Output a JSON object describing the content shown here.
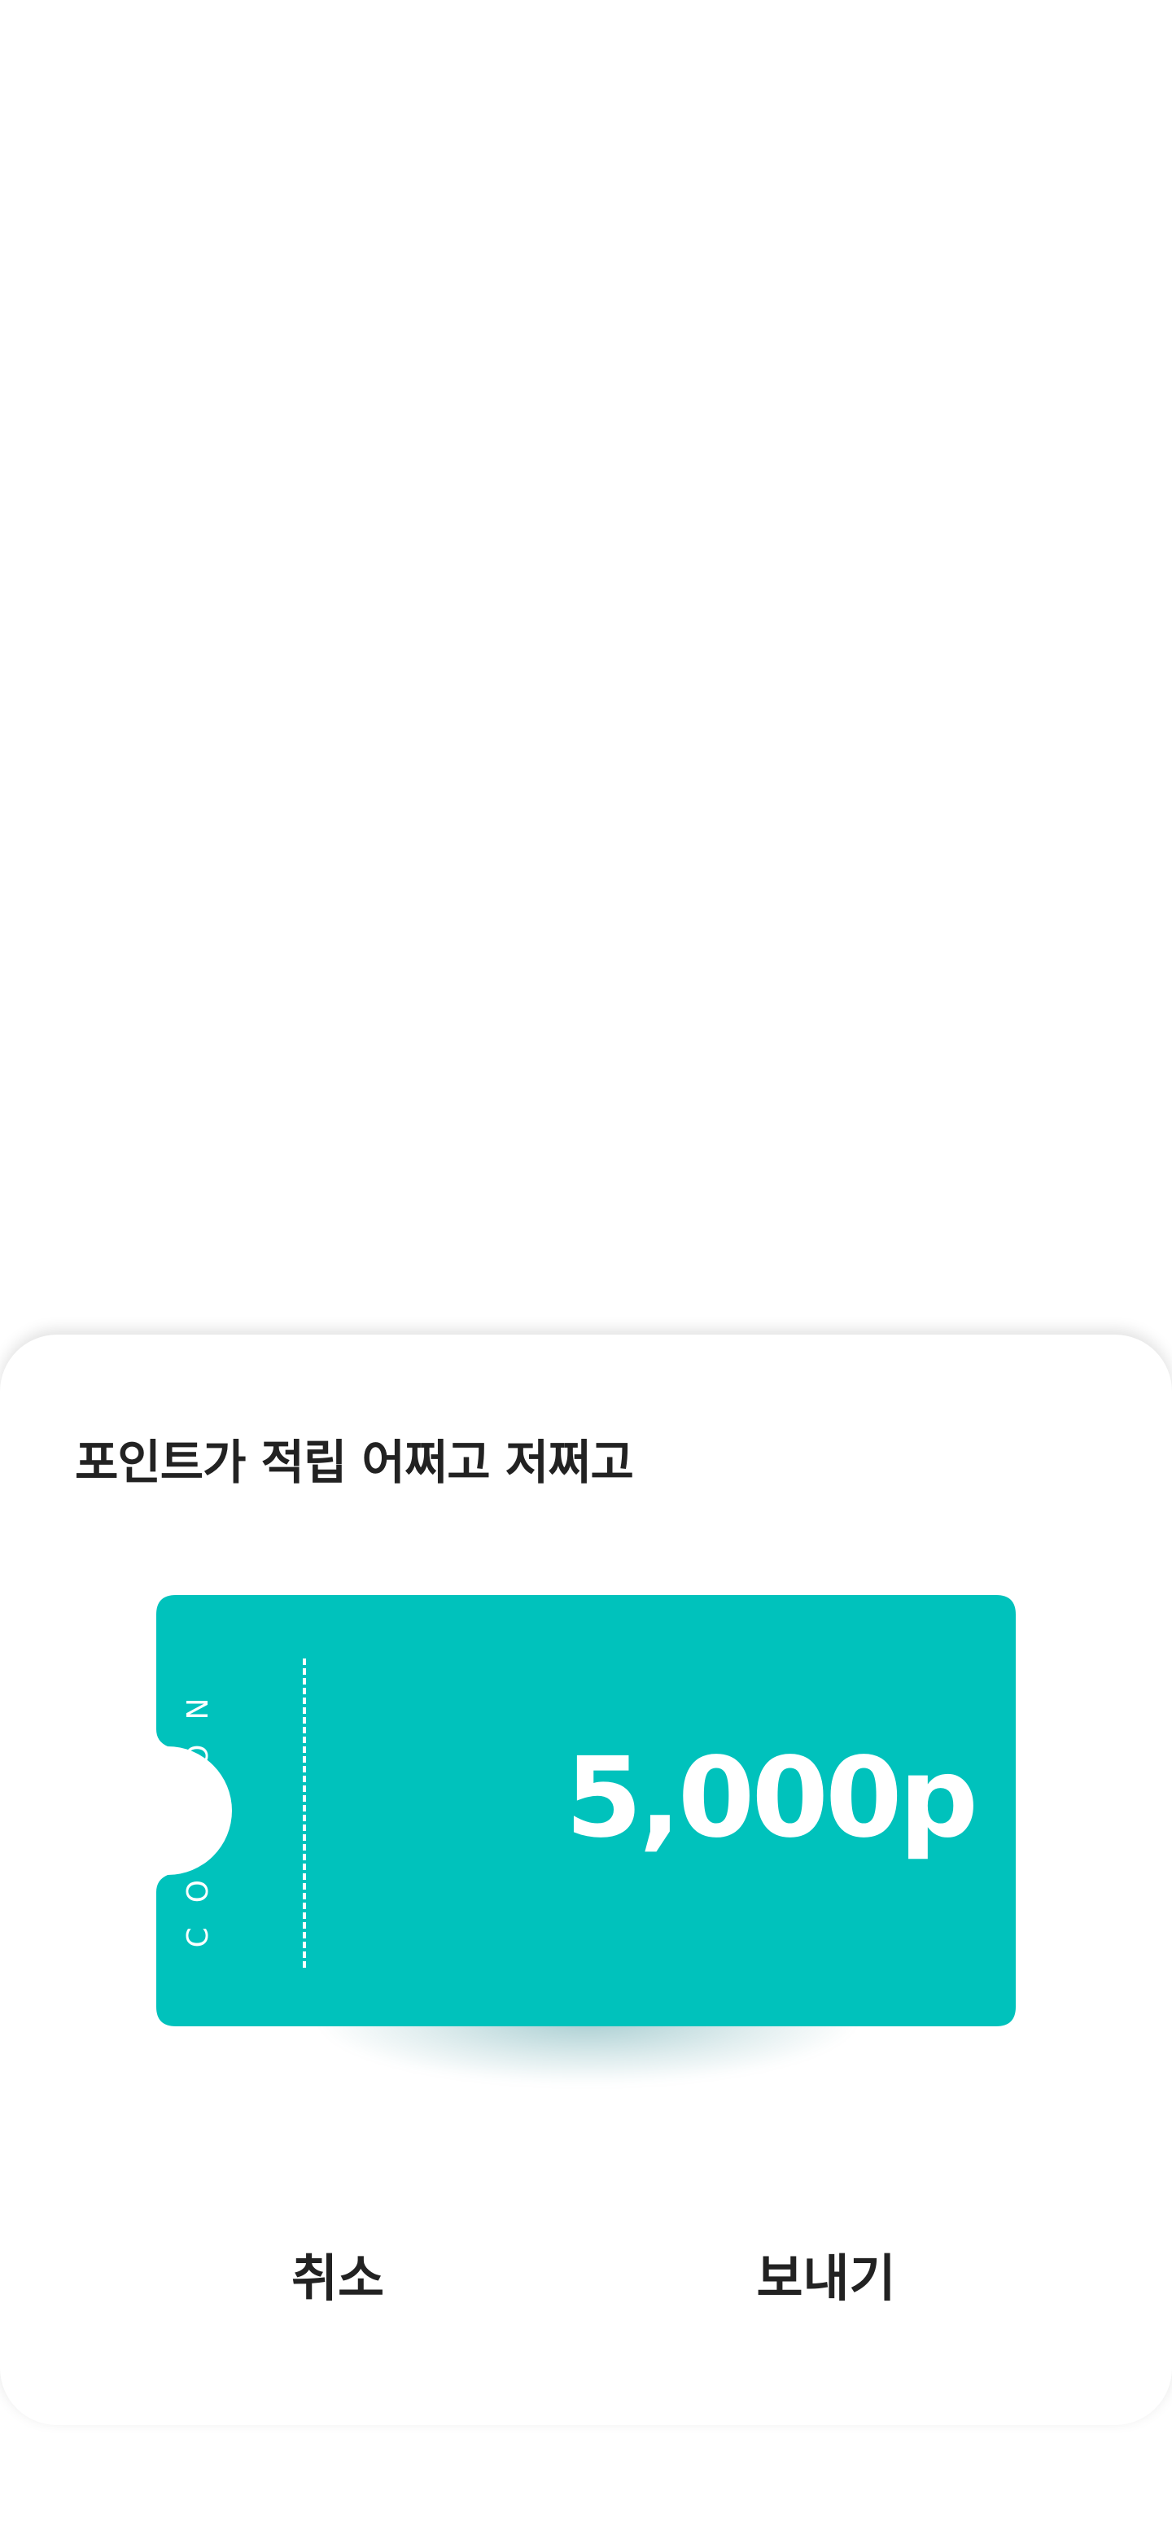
{
  "sheet": {
    "title": "포인트가 적립 어쩌고 저쩌고"
  },
  "coupon": {
    "label": "COUPON",
    "value": "5,000p",
    "color": "#00C2BC"
  },
  "actions": {
    "cancel_label": "취소",
    "send_label": "보내기"
  }
}
